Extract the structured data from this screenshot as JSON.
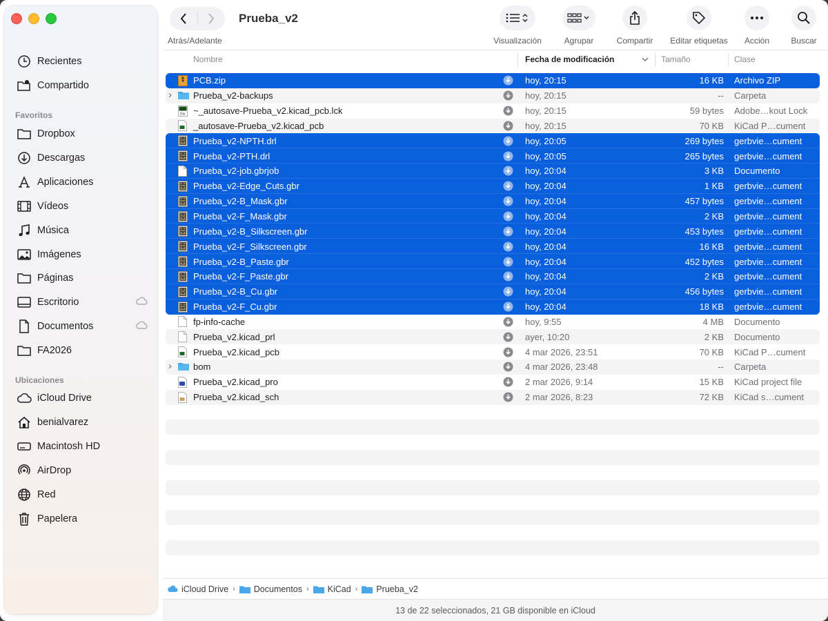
{
  "window": {
    "title": "Prueba_v2"
  },
  "sidebar": {
    "top_items": [
      {
        "label": "Recientes",
        "icon": "clock-icon"
      },
      {
        "label": "Compartido",
        "icon": "shared-folder-icon"
      }
    ],
    "favorites_header": "Favoritos",
    "favorites": [
      {
        "label": "Dropbox",
        "icon": "folder-icon"
      },
      {
        "label": "Descargas",
        "icon": "download-icon"
      },
      {
        "label": "Aplicaciones",
        "icon": "applications-icon"
      },
      {
        "label": "Vídeos",
        "icon": "film-icon"
      },
      {
        "label": "Música",
        "icon": "music-icon"
      },
      {
        "label": "Imágenes",
        "icon": "photo-icon"
      },
      {
        "label": "Páginas",
        "icon": "folder-icon"
      },
      {
        "label": "Escritorio",
        "icon": "desktop-icon"
      },
      {
        "label": "Documentos",
        "icon": "document-icon"
      },
      {
        "label": "FA2026",
        "icon": "folder-icon"
      }
    ],
    "locations_header": "Ubicaciones",
    "locations": [
      {
        "label": "iCloud Drive",
        "icon": "icloud-icon"
      },
      {
        "label": "benialvarez",
        "icon": "home-icon"
      },
      {
        "label": "Macintosh HD",
        "icon": "hard-drive-icon"
      },
      {
        "label": "AirDrop",
        "icon": "airdrop-icon"
      },
      {
        "label": "Red",
        "icon": "globe-icon"
      },
      {
        "label": "Papelera",
        "icon": "trash-icon"
      }
    ]
  },
  "toolbar": {
    "nav_label": "Atrás/Adelante",
    "view_label": "Visualización",
    "group_label": "Agrupar",
    "share_label": "Compartir",
    "tags_label": "Editar etiquetas",
    "action_label": "Acción",
    "search_label": "Buscar"
  },
  "columns": {
    "name": "Nombre",
    "date": "Fecha de modificación",
    "size": "Tamaño",
    "kind": "Clase"
  },
  "files": [
    {
      "name": "PCB.zip",
      "date": "hoy, 20:15",
      "size": "16 KB",
      "kind": "Archivo ZIP",
      "selected": true,
      "icon": "zip-icon",
      "folder": false
    },
    {
      "name": "Prueba_v2-backups",
      "date": "hoy, 20:15",
      "size": "--",
      "kind": "Carpeta",
      "selected": false,
      "icon": "folder-icon",
      "folder": true
    },
    {
      "name": "~_autosave-Prueba_v2.kicad_pcb.lck",
      "date": "hoy, 20:15",
      "size": "59 bytes",
      "kind": "Adobe…kout Lock",
      "selected": false,
      "icon": "lock-file-icon",
      "folder": false
    },
    {
      "name": "_autosave-Prueba_v2.kicad_pcb",
      "date": "hoy, 20:15",
      "size": "70 KB",
      "kind": "KiCad P…cument",
      "selected": false,
      "icon": "kicad-pcb-icon",
      "folder": false
    },
    {
      "name": "Prueba_v2-NPTH.drl",
      "date": "hoy, 20:05",
      "size": "269 bytes",
      "kind": "gerbvie…cument",
      "selected": true,
      "icon": "gerber-icon",
      "folder": false
    },
    {
      "name": "Prueba_v2-PTH.drl",
      "date": "hoy, 20:05",
      "size": "265 bytes",
      "kind": "gerbvie…cument",
      "selected": true,
      "icon": "gerber-icon",
      "folder": false
    },
    {
      "name": "Prueba_v2-job.gbrjob",
      "date": "hoy, 20:04",
      "size": "3 KB",
      "kind": "Documento",
      "selected": true,
      "icon": "blank-document-icon",
      "folder": false
    },
    {
      "name": "Prueba_v2-Edge_Cuts.gbr",
      "date": "hoy, 20:04",
      "size": "1 KB",
      "kind": "gerbvie…cument",
      "selected": true,
      "icon": "gerber-icon",
      "folder": false
    },
    {
      "name": "Prueba_v2-B_Mask.gbr",
      "date": "hoy, 20:04",
      "size": "457 bytes",
      "kind": "gerbvie…cument",
      "selected": true,
      "icon": "gerber-icon",
      "folder": false
    },
    {
      "name": "Prueba_v2-F_Mask.gbr",
      "date": "hoy, 20:04",
      "size": "2 KB",
      "kind": "gerbvie…cument",
      "selected": true,
      "icon": "gerber-icon",
      "folder": false
    },
    {
      "name": "Prueba_v2-B_Silkscreen.gbr",
      "date": "hoy, 20:04",
      "size": "453 bytes",
      "kind": "gerbvie…cument",
      "selected": true,
      "icon": "gerber-icon",
      "folder": false
    },
    {
      "name": "Prueba_v2-F_Silkscreen.gbr",
      "date": "hoy, 20:04",
      "size": "16 KB",
      "kind": "gerbvie…cument",
      "selected": true,
      "icon": "gerber-icon",
      "folder": false
    },
    {
      "name": "Prueba_v2-B_Paste.gbr",
      "date": "hoy, 20:04",
      "size": "452 bytes",
      "kind": "gerbvie…cument",
      "selected": true,
      "icon": "gerber-icon",
      "folder": false
    },
    {
      "name": "Prueba_v2-F_Paste.gbr",
      "date": "hoy, 20:04",
      "size": "2 KB",
      "kind": "gerbvie…cument",
      "selected": true,
      "icon": "gerber-icon",
      "folder": false
    },
    {
      "name": "Prueba_v2-B_Cu.gbr",
      "date": "hoy, 20:04",
      "size": "456 bytes",
      "kind": "gerbvie…cument",
      "selected": true,
      "icon": "gerber-icon",
      "folder": false
    },
    {
      "name": "Prueba_v2-F_Cu.gbr",
      "date": "hoy, 20:04",
      "size": "18 KB",
      "kind": "gerbvie…cument",
      "selected": true,
      "icon": "gerber-icon",
      "folder": false
    },
    {
      "name": "fp-info-cache",
      "date": "hoy, 9:55",
      "size": "4 MB",
      "kind": "Documento",
      "selected": false,
      "icon": "blank-document-icon",
      "folder": false
    },
    {
      "name": "Prueba_v2.kicad_prl",
      "date": "ayer, 10:20",
      "size": "2 KB",
      "kind": "Documento",
      "selected": false,
      "icon": "blank-document-icon",
      "folder": false
    },
    {
      "name": "Prueba_v2.kicad_pcb",
      "date": "4 mar 2026, 23:51",
      "size": "70 KB",
      "kind": "KiCad P…cument",
      "selected": false,
      "icon": "kicad-pcb-icon",
      "folder": false
    },
    {
      "name": "bom",
      "date": "4 mar 2026, 23:48",
      "size": "--",
      "kind": "Carpeta",
      "selected": false,
      "icon": "folder-icon",
      "folder": true
    },
    {
      "name": "Prueba_v2.kicad_pro",
      "date": "2 mar 2026, 9:14",
      "size": "15 KB",
      "kind": "KiCad project file",
      "selected": false,
      "icon": "kicad-project-icon",
      "folder": false
    },
    {
      "name": "Prueba_v2.kicad_sch",
      "date": "2 mar 2026, 8:23",
      "size": "72 KB",
      "kind": "KiCad s…cument",
      "selected": false,
      "icon": "kicad-schematic-icon",
      "folder": false
    }
  ],
  "pathbar": [
    "iCloud Drive",
    "Documentos",
    "KiCad",
    "Prueba_v2"
  ],
  "status": "13 de 22 seleccionados, 21 GB disponible en iCloud",
  "colors": {
    "selection": "#0a5fdd",
    "folder": "#4aa8e8",
    "close": "#fe5f57",
    "minimize": "#febc2e",
    "maximize": "#28c840"
  }
}
